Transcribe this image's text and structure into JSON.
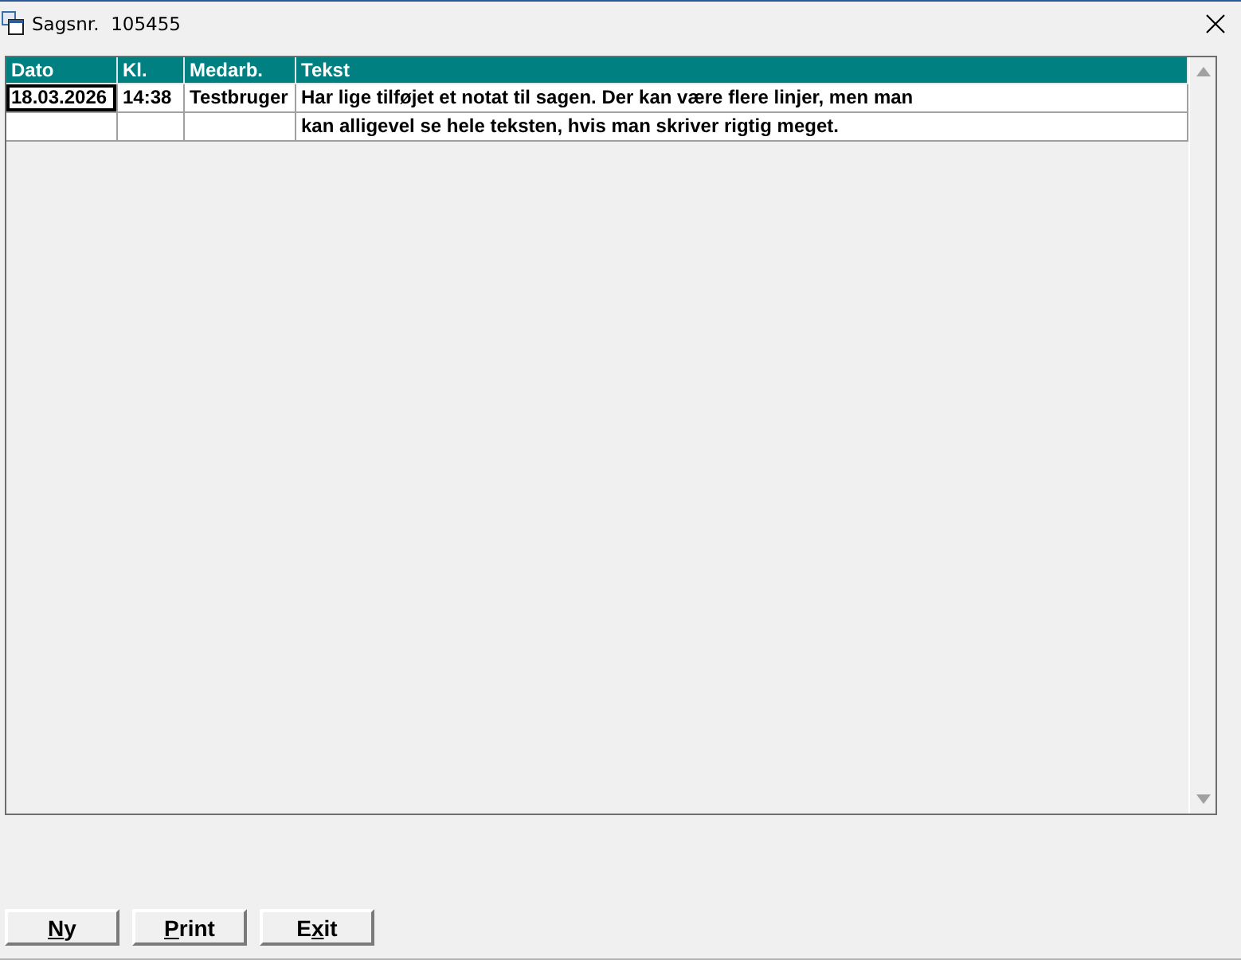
{
  "window": {
    "title": "Sagsnr.  105455"
  },
  "table": {
    "columns": [
      "Dato",
      "Kl.",
      "Medarb.",
      "Tekst"
    ],
    "rows": [
      {
        "cells": [
          {
            "text": "18.03.2026",
            "focused": true
          },
          {
            "text": "14:38",
            "focused": false
          },
          {
            "text": "Testbruger",
            "focused": false
          },
          {
            "text": "Har lige tilføjet et notat til sagen. Der kan være flere linjer, men man",
            "focused": false
          }
        ]
      },
      {
        "cells": [
          {
            "focused": false
          },
          {
            "focused": false
          },
          {
            "focused": false
          },
          {
            "text": "kan alligevel se hele teksten, hvis man skriver rigtig meget.",
            "focused": false
          }
        ]
      }
    ]
  },
  "buttons": [
    {
      "key": "N",
      "after": "y"
    },
    {
      "key": "P",
      "after": "rint"
    },
    {
      "before": "E",
      "key": "x",
      "after": "it"
    }
  ]
}
